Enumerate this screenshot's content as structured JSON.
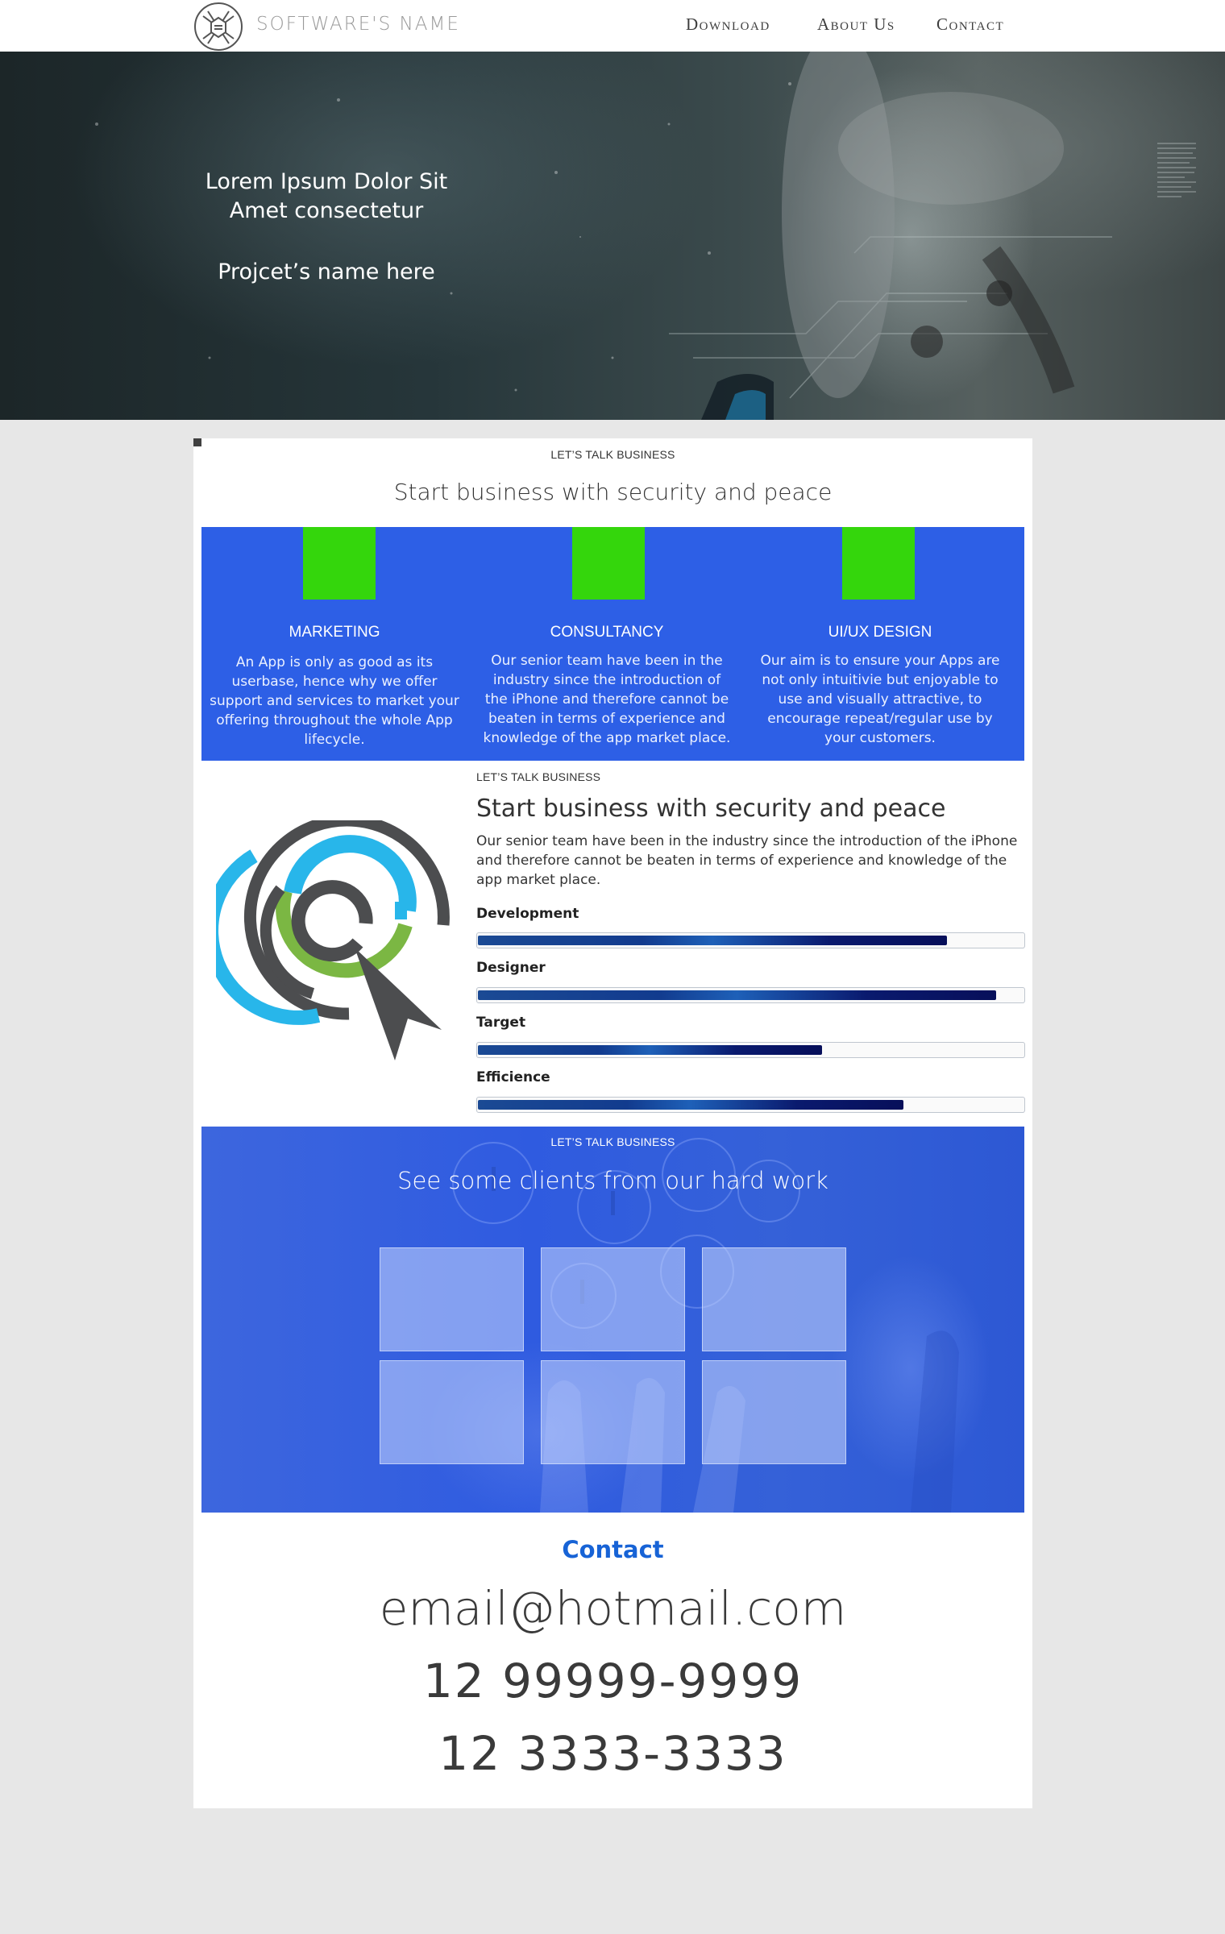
{
  "header": {
    "brand": "SOFTWARE'S NAME",
    "nav": [
      "Download",
      "About Us",
      "Contact"
    ]
  },
  "hero": {
    "line1": "Lorem Ipsum Dolor Sit",
    "line2": "Amet consectetur",
    "line3": "Projcet’s name here"
  },
  "intro": {
    "eyebrow": "LET’S TALK BUSINESS",
    "title": "Start business with security and peace"
  },
  "services": [
    {
      "title": "MARKETING",
      "desc": "An App is only as good as its userbase, hence why we offer support and services to market your offering throughout the whole App lifecycle."
    },
    {
      "title": "CONSULTANCY",
      "desc": "Our senior team have been in the industry since the introduction of the iPhone and therefore cannot be beaten in terms of experience and knowledge of the app market place."
    },
    {
      "title": "UI/UX DESIGN",
      "desc": "Our aim is to ensure your Apps are not only intuitivie but enjoyable to use and visually attractive, to encourage repeat/regular use by your customers."
    }
  ],
  "about": {
    "eyebrow": "LET’S TALK BUSINESS",
    "title": "Start business with security and peace",
    "body": "Our senior team have been in the industry since the introduction of the iPhone and therefore cannot be beaten in terms of experience and knowledge of the app market place.",
    "skills": [
      {
        "label": "Development",
        "level": 0.86
      },
      {
        "label": "Designer",
        "level": 0.95
      },
      {
        "label": "Target",
        "level": 0.63
      },
      {
        "label": "Efficience",
        "level": 0.78
      }
    ]
  },
  "clients": {
    "eyebrow": "LET’S TALK BUSINESS",
    "title": "See some clients from our hard work"
  },
  "contact": {
    "heading": "Contact",
    "email": "email@hotmail.com",
    "phone1": "12 99999-9999",
    "phone2": "12 3333-3333"
  },
  "colors": {
    "service_bg": "#2d5fe6",
    "service_square": "#34d60c",
    "contact_heading": "#1763d6",
    "page_bg": "#e7e7e7"
  }
}
